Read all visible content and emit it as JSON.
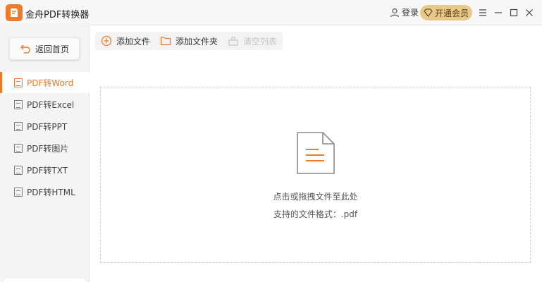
{
  "app": {
    "title": "金舟PDF转换器"
  },
  "header": {
    "login_label": "登录",
    "vip_label": "开通会员"
  },
  "sidebar": {
    "back_label": "返回首页",
    "items": [
      {
        "label": "PDF转Word",
        "active": true
      },
      {
        "label": "PDF转Excel",
        "active": false
      },
      {
        "label": "PDF转PPT",
        "active": false
      },
      {
        "label": "PDF转图片",
        "active": false
      },
      {
        "label": "PDF转TXT",
        "active": false
      },
      {
        "label": "PDF转HTML",
        "active": false
      }
    ]
  },
  "toolbar": {
    "add_file_label": "添加文件",
    "add_folder_label": "添加文件夹",
    "clear_list_label": "清空列表"
  },
  "dropzone": {
    "hint": "点击或拖拽文件至此处",
    "formats": "支持的文件格式：.pdf"
  },
  "colors": {
    "accent": "#f07a2a",
    "vip_bg": "#e8c98c"
  }
}
